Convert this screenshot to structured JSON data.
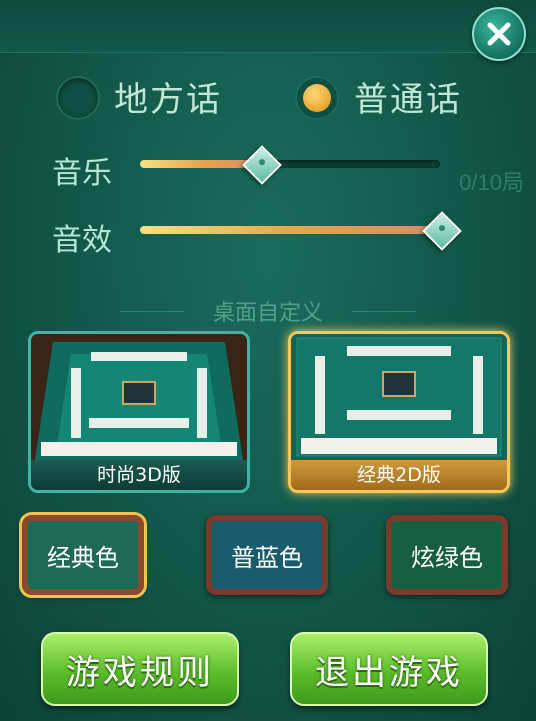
{
  "dialect": {
    "option_local": "地方话",
    "option_mandarin": "普通话",
    "selected": "普通话"
  },
  "background": {
    "round_counter": "0/10局"
  },
  "sliders": {
    "music": {
      "label": "音乐",
      "level": 0.4
    },
    "effects": {
      "label": "音效",
      "level": 1.0
    }
  },
  "table_custom": {
    "title": "桌面自定义",
    "themes": [
      {
        "caption": "时尚3D版",
        "selected": false
      },
      {
        "caption": "经典2D版",
        "selected": true
      }
    ],
    "colors": [
      {
        "label": "经典色",
        "selected": true,
        "color": "#1f6a56"
      },
      {
        "label": "普蓝色",
        "selected": false,
        "color": "#1a5b6e"
      },
      {
        "label": "炫绿色",
        "selected": false,
        "color": "#175f3e"
      }
    ]
  },
  "actions": {
    "rules": "游戏规则",
    "exit": "退出游戏"
  },
  "colors": {
    "accent_gold": "#f6c75a",
    "button_green": "#5cbd2b",
    "panel_green": "#135a4c"
  }
}
